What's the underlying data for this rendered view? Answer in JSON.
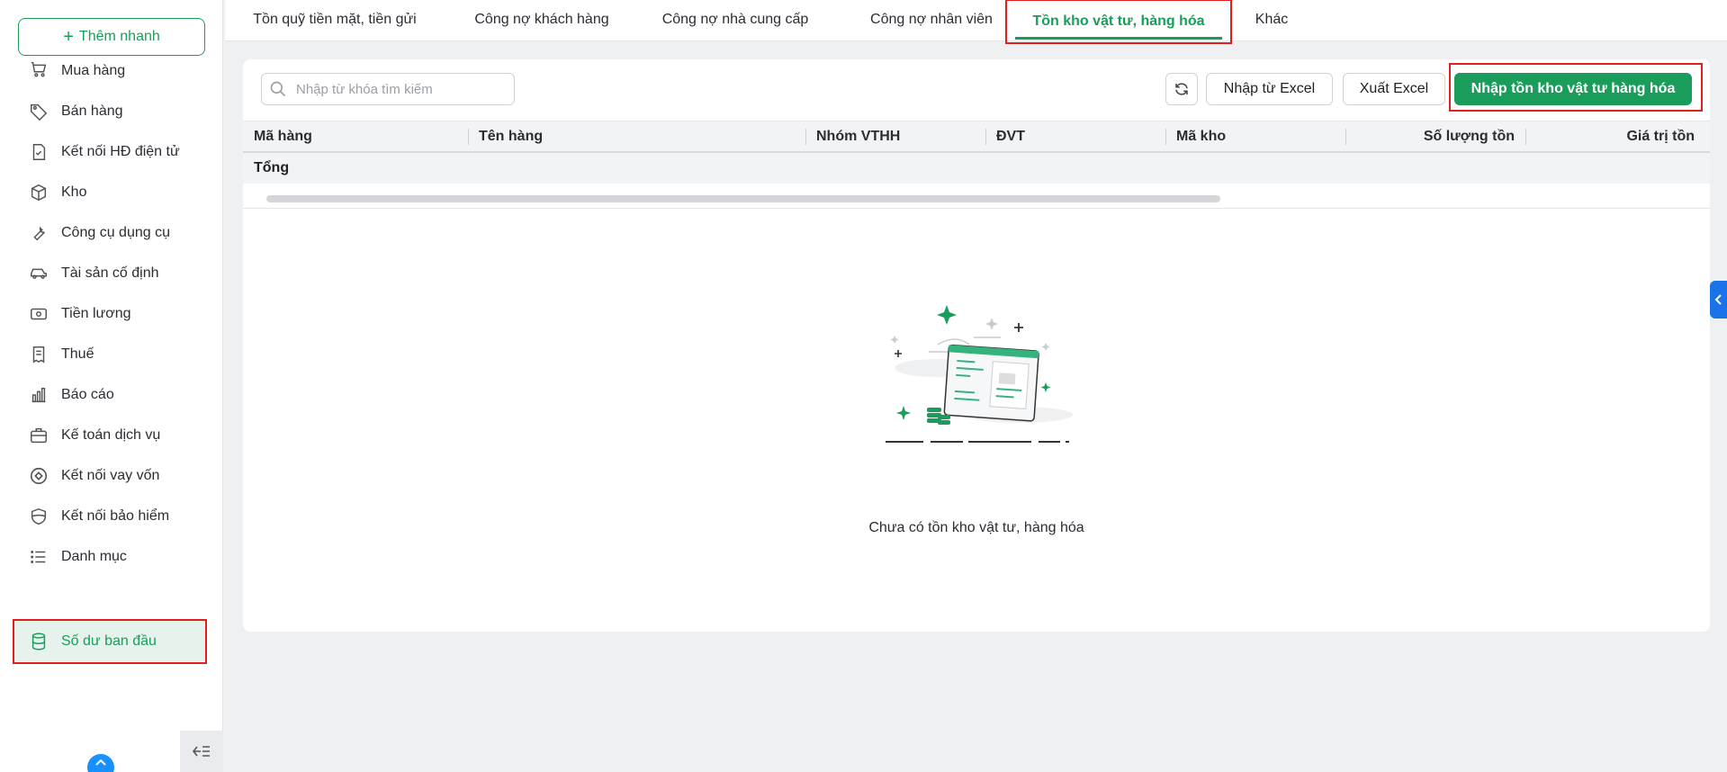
{
  "sidebar": {
    "quick_add_label": "Thêm nhanh",
    "items": [
      {
        "label": "Mua hàng",
        "icon": "cart-icon"
      },
      {
        "label": "Bán hàng",
        "icon": "tag-icon"
      },
      {
        "label": "Kết nối HĐ điện tử",
        "icon": "e-invoice-icon"
      },
      {
        "label": "Kho",
        "icon": "box-icon"
      },
      {
        "label": "Công cụ dụng cụ",
        "icon": "wrench-icon"
      },
      {
        "label": "Tài sản cố định",
        "icon": "car-icon"
      },
      {
        "label": "Tiền lương",
        "icon": "money-icon"
      },
      {
        "label": "Thuế",
        "icon": "receipt-icon"
      },
      {
        "label": "Báo cáo",
        "icon": "bar-chart-icon"
      },
      {
        "label": "Kế toán dịch vụ",
        "icon": "briefcase-icon"
      },
      {
        "label": "Kết nối vay vốn",
        "icon": "loan-icon"
      },
      {
        "label": "Kết nối bảo hiểm",
        "icon": "shield-icon"
      },
      {
        "label": "Danh mục",
        "icon": "list-icon"
      },
      {
        "label": "Số dư ban đầu",
        "icon": "database-icon"
      }
    ]
  },
  "tabs": [
    {
      "label": "Tồn quỹ tiền mặt, tiền gửi"
    },
    {
      "label": "Công nợ khách hàng"
    },
    {
      "label": "Công nợ nhà cung cấp"
    },
    {
      "label": "Công nợ nhân viên"
    },
    {
      "label": "Tồn kho vật tư, hàng hóa"
    },
    {
      "label": "Khác"
    }
  ],
  "toolbar": {
    "search_placeholder": "Nhập từ khóa tìm kiếm",
    "import_excel_label": "Nhập từ Excel",
    "export_excel_label": "Xuất Excel",
    "import_stock_label": "Nhập tồn kho vật tư hàng hóa"
  },
  "table": {
    "columns": [
      "Mã hàng",
      "Tên hàng",
      "Nhóm VTHH",
      "ĐVT",
      "Mã kho",
      "Số lượng tồn",
      "Giá trị tồn"
    ],
    "total_label": "Tổng"
  },
  "empty_state": {
    "message": "Chưa có tồn kho vật tư, hàng hóa"
  },
  "colors": {
    "accent": "#1a9c5b",
    "highlight": "#e02020",
    "side_toggle": "#1a73e8"
  }
}
